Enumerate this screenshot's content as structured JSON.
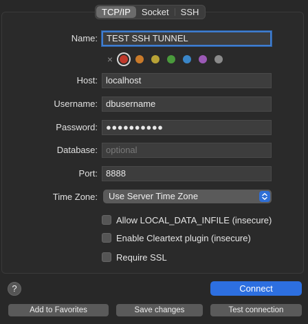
{
  "tabs": [
    "TCP/IP",
    "Socket",
    "SSH"
  ],
  "active_tab": "TCP/IP",
  "form": {
    "name_label": "Name:",
    "name_value": "TEST SSH TUNNEL",
    "color_none": "×",
    "colors": [
      "#c0392b",
      "#c97a2a",
      "#b8a236",
      "#4a9a3c",
      "#3a86c8",
      "#9b59b6",
      "#8a8a8a"
    ],
    "selected_color": "#c0392b",
    "host_label": "Host:",
    "host_value": "localhost",
    "username_label": "Username:",
    "username_value": "dbusername",
    "password_label": "Password:",
    "password_value": "●●●●●●●●●●",
    "database_label": "Database:",
    "database_placeholder": "optional",
    "port_label": "Port:",
    "port_value": "8888",
    "timezone_label": "Time Zone:",
    "timezone_value": "Use Server Time Zone"
  },
  "checkboxes": [
    {
      "label": "Allow LOCAL_DATA_INFILE (insecure)",
      "checked": false
    },
    {
      "label": "Enable Cleartext plugin (insecure)",
      "checked": false
    },
    {
      "label": "Require SSL",
      "checked": false
    }
  ],
  "buttons": {
    "help": "?",
    "connect": "Connect",
    "add_favorites": "Add to Favorites",
    "save_changes": "Save changes",
    "test_connection": "Test connection"
  }
}
